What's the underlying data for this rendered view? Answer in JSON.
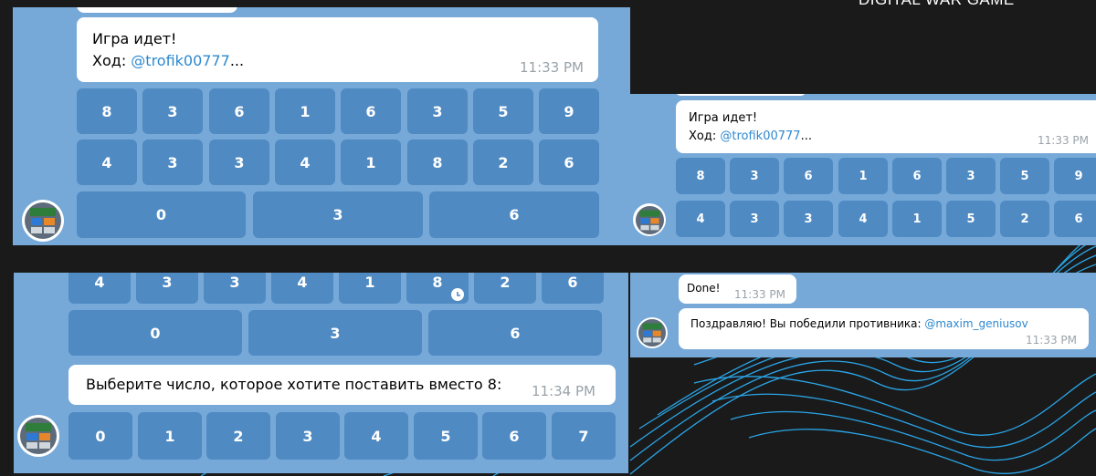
{
  "page": {
    "title": "DIGITAL WAR GAME"
  },
  "colors": {
    "panel_bg": "#76a9d8",
    "key_bg": "#4f8ac3",
    "mention": "#2d88cf",
    "time": "#99a3aa",
    "page_bg": "#1a1a1a",
    "waves": "#2aa4e6"
  },
  "icons": {
    "avatar": "calculator-bot-avatar",
    "pending": "clock-icon"
  },
  "panel1": {
    "message": {
      "line1": "Игра идет!",
      "prefix": "Ход: ",
      "mention": "@trofik00777",
      "ellipsis": "...",
      "time": "11:33 PM"
    },
    "row1": [
      "8",
      "3",
      "6",
      "1",
      "6",
      "3",
      "5",
      "9"
    ],
    "row2": [
      "4",
      "3",
      "3",
      "4",
      "1",
      "8",
      "2",
      "6"
    ],
    "row3": [
      "0",
      "3",
      "6"
    ]
  },
  "panel2": {
    "message": {
      "line1": "Игра идет!",
      "prefix": "Ход: ",
      "mention": "@trofik00777",
      "ellipsis": "...",
      "time": "11:33 PM"
    },
    "row1": [
      "8",
      "3",
      "6",
      "1",
      "6",
      "3",
      "5",
      "9"
    ],
    "row2": [
      "4",
      "3",
      "3",
      "4",
      "1",
      "5",
      "2",
      "6"
    ]
  },
  "panel3": {
    "row2": [
      "4",
      "3",
      "3",
      "4",
      "1",
      "8",
      "2",
      "6"
    ],
    "row3": [
      "0",
      "3",
      "6"
    ],
    "message": {
      "text": "Выберите число, которое хотите поставить вместо 8:",
      "time": "11:34 PM"
    },
    "choices": [
      "0",
      "1",
      "2",
      "3",
      "4",
      "5",
      "6",
      "7"
    ]
  },
  "panel4": {
    "done": {
      "text": "Done!",
      "time": "11:33 PM"
    },
    "message": {
      "text": "Поздравляю! Вы победили противника: ",
      "mention": "@maxim_geniusov",
      "time": "11:33 PM"
    }
  }
}
